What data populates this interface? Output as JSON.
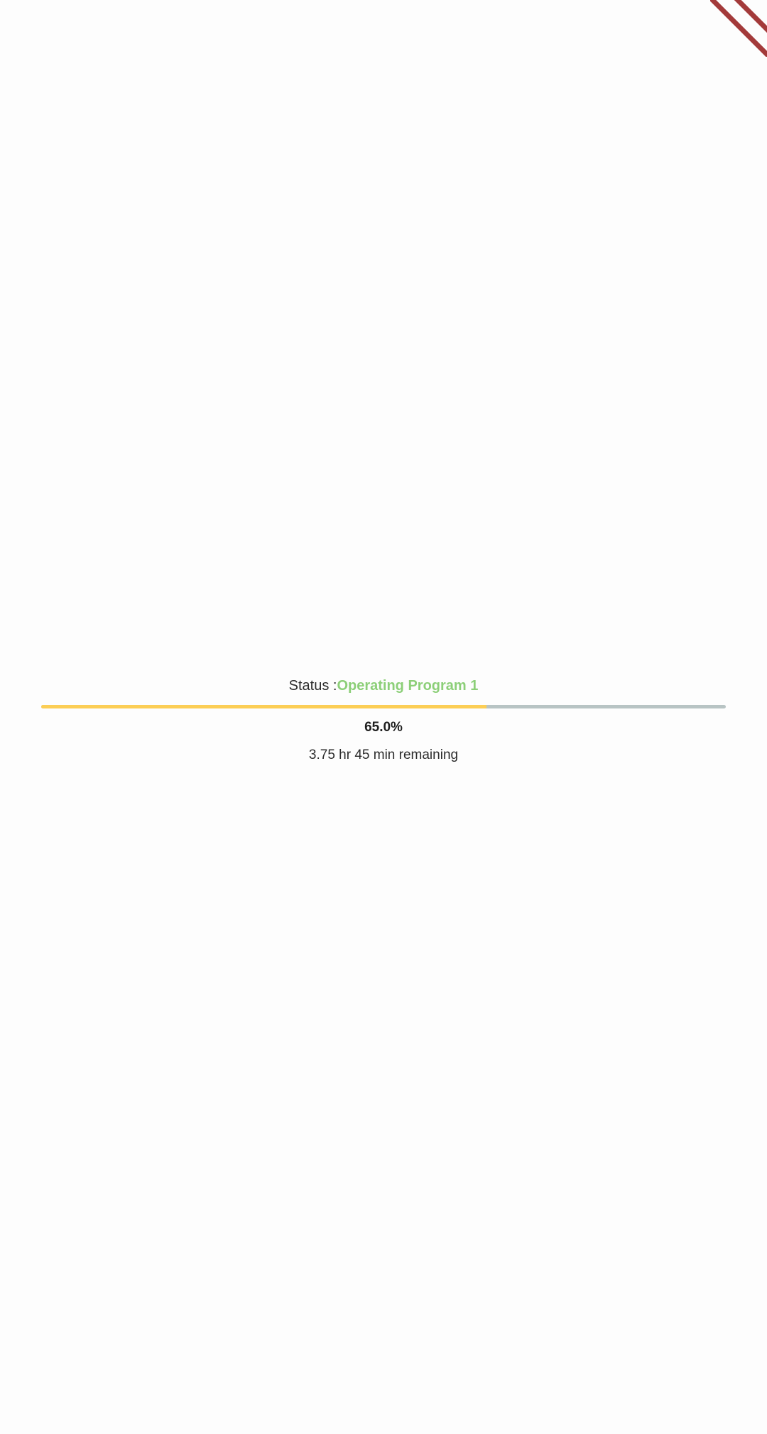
{
  "status": {
    "label": "Status :",
    "value": "Operating Program 1",
    "value_color": "#8ccf78"
  },
  "progress": {
    "fraction": 0.65,
    "percent_text": "65.0%",
    "fill_color": "#fcce55",
    "track_color": "#b8c4c4"
  },
  "remaining": {
    "text": "3.75 hr 45 min remaining"
  },
  "debug_banner": {
    "icon": "debug-ribbon-icon",
    "color": "#a33a3a"
  }
}
